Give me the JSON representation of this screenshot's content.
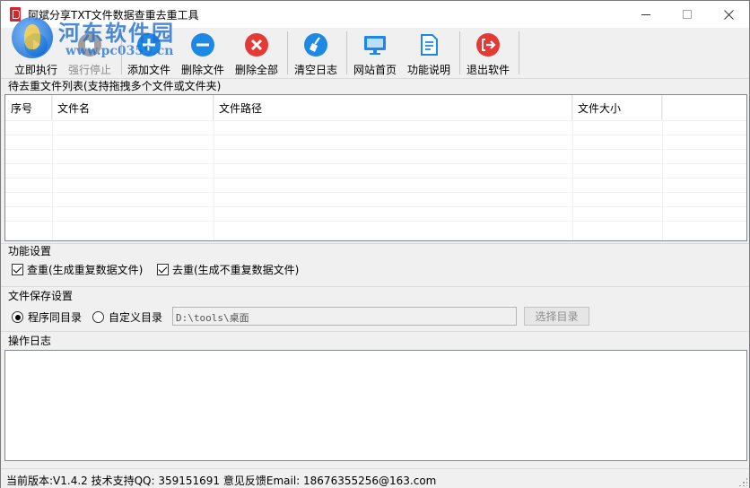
{
  "window": {
    "title": "阿斌分享TXT文件数据查重去重工具",
    "controls": [
      "minimize",
      "maximize",
      "close"
    ]
  },
  "watermark": {
    "title": "河东软件园",
    "url": "www.pc0359.cn"
  },
  "toolbar": {
    "buttons": [
      {
        "label": "立即执行",
        "icon": "play-icon",
        "enabled": true
      },
      {
        "label": "强行停止",
        "icon": "stop-icon",
        "enabled": false
      },
      {
        "label": "添加文件",
        "icon": "plus-circle-icon",
        "enabled": true
      },
      {
        "label": "删除文件",
        "icon": "minus-circle-icon",
        "enabled": true
      },
      {
        "label": "删除全部",
        "icon": "x-circle-icon",
        "enabled": true
      },
      {
        "label": "清空日志",
        "icon": "broom-icon",
        "enabled": true
      },
      {
        "label": "网站首页",
        "icon": "monitor-icon",
        "enabled": true
      },
      {
        "label": "功能说明",
        "icon": "document-icon",
        "enabled": true
      },
      {
        "label": "退出软件",
        "icon": "exit-icon",
        "enabled": true
      }
    ]
  },
  "file_list": {
    "label": "待去重文件列表(支持拖拽多个文件或文件夹)",
    "columns": [
      "序号",
      "文件名",
      "文件路径",
      "文件大小"
    ],
    "rows": []
  },
  "function_settings": {
    "label": "功能设置",
    "check_dup": {
      "label": "查重(生成重复数据文件)",
      "checked": true
    },
    "dedup": {
      "label": "去重(生成不重复数据文件)",
      "checked": true
    }
  },
  "save_settings": {
    "label": "文件保存设置",
    "same_dir": {
      "label": "程序同目录",
      "checked": true
    },
    "custom_dir": {
      "label": "自定义目录",
      "checked": false
    },
    "path_value": "D:\\tools\\桌面",
    "select_button": "选择目录"
  },
  "log": {
    "label": "操作日志",
    "content": ""
  },
  "status": {
    "text": "当前版本:V1.4.2   技术支持QQ: 359151691   意见反馈Email: 18676355256@163.com"
  },
  "colors": {
    "accent_blue": "#1e88e5",
    "danger_red": "#e53935",
    "disabled_gray": "#8c8c8c"
  }
}
